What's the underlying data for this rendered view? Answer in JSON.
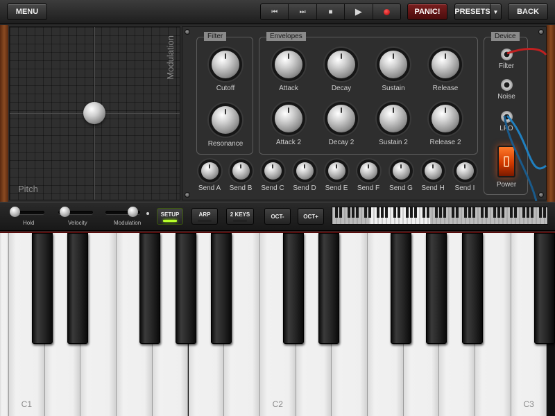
{
  "topbar": {
    "menu": "MENU",
    "panic": "PANIC!",
    "presets": "PRESETS",
    "back": "BACK",
    "transport": [
      "⏮",
      "⏭",
      "■",
      "▶"
    ]
  },
  "xypad": {
    "x_label": "Pitch",
    "y_label": "Modulation"
  },
  "filter": {
    "title": "Filter",
    "knobs": [
      "Cutoff",
      "Resonance"
    ]
  },
  "envelopes": {
    "title": "Envelopes",
    "row1": [
      "Attack",
      "Decay",
      "Sustain",
      "Release"
    ],
    "row2": [
      "Attack 2",
      "Decay 2",
      "Sustain 2",
      "Release 2"
    ]
  },
  "sends": [
    "Send A",
    "Send B",
    "Send C",
    "Send D",
    "Send E",
    "Send F",
    "Send G",
    "Send H",
    "Send I"
  ],
  "device": {
    "title": "Device",
    "jacks": [
      "Filter",
      "Noise",
      "LFO"
    ],
    "power": "Power"
  },
  "strip": {
    "sliders": [
      "Hold",
      "Velocity",
      "Modulation"
    ],
    "setup": "SETUP",
    "arp": "ARP",
    "two_keys": "2 KEYS",
    "oct_down": "OCT-",
    "oct_up": "OCT+"
  },
  "keyboard": {
    "labels": [
      "C1",
      "C2",
      "C3"
    ]
  },
  "colors": {
    "accent_led": "#b8ff2a",
    "panic": "#7a1f1f",
    "power": "#ff5a14",
    "cable_red": "#c02020",
    "cable_blue": "#2080c0"
  }
}
